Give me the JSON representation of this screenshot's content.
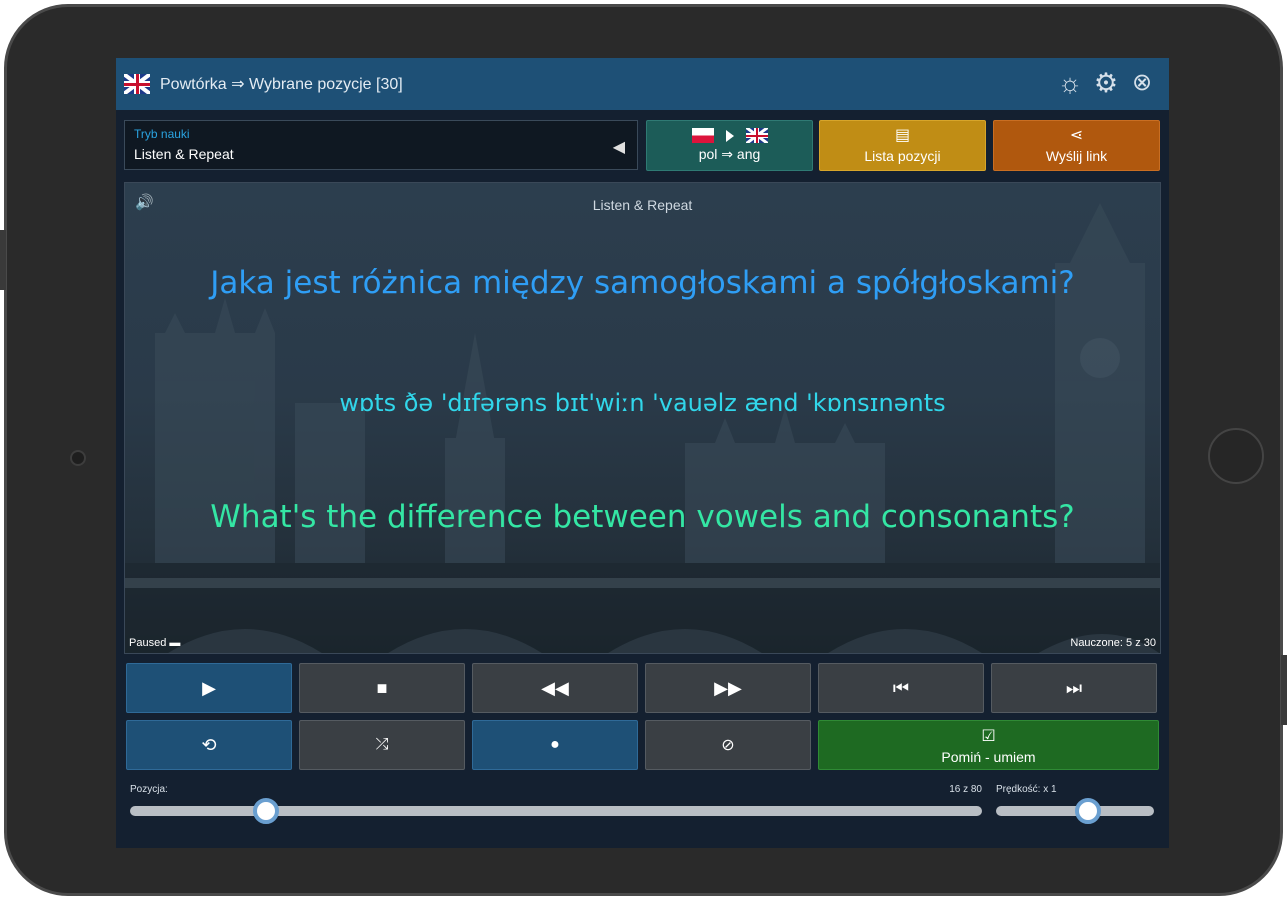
{
  "titlebar": {
    "title": "Powtórka ⇒ Wybrane pozycje [30]"
  },
  "mode": {
    "label": "Tryb nauki",
    "value": "Listen & Repeat"
  },
  "buttons": {
    "lang_pair": "pol ⇒ ang",
    "list": "Lista pozycji",
    "send": "Wyślij link",
    "skip": "Pomiń - umiem"
  },
  "stage": {
    "header": "Listen & Repeat",
    "question_pl": "Jaka jest różnica między samogłoskami a spółgłoskami?",
    "phonetic": "wɒts ðə 'dɪfərəns bɪt'wiːn 'vauəlz ænd 'kɒnsɪnənts",
    "answer_en": "What's the difference between vowels and consonants?",
    "status_left": "Paused ▬",
    "status_right": "Nauczone: 5 z 30"
  },
  "sliders": {
    "position_label": "Pozycja:",
    "position_counter": "16 z 80",
    "position_value": 0.16,
    "speed_label": "Prędkość: x 1",
    "speed_value": 0.58
  },
  "colors": {
    "accent_blue": "#1e5076",
    "lang_teal": "#1c5c58",
    "list_gold": "#c08d15",
    "send_orange": "#b0580e",
    "skip_green": "#1e6a22",
    "text_pl": "#2f9ef5",
    "text_ipa": "#31d6ea",
    "text_en": "#34e6a4"
  },
  "icons": {
    "flag": "uk-flag-icon",
    "sun": "sun-icon",
    "settings": "gear-icon",
    "close": "close-icon",
    "speaker": "speaker-icon",
    "play": "play-icon",
    "stop": "stop-icon",
    "rewind": "rewind-icon",
    "fast_forward": "fast-forward-icon",
    "skip_start": "skip-start-icon",
    "skip_end": "skip-end-icon",
    "repeat": "repeat-icon",
    "shuffle": "shuffle-icon",
    "user": "user-icon",
    "mute": "bell-slash-icon",
    "check": "check-icon"
  }
}
